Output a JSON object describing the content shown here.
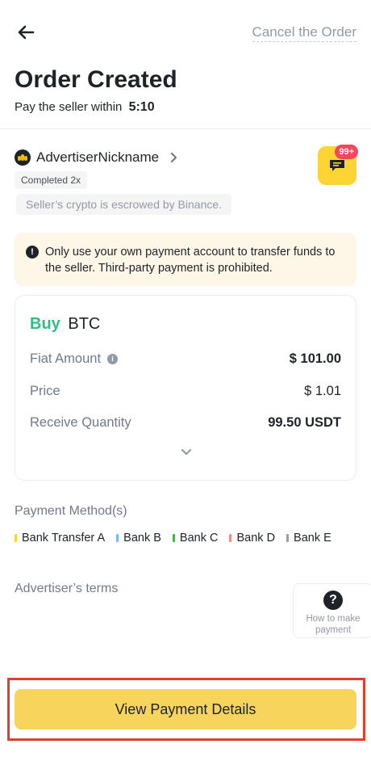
{
  "header": {
    "back_icon": "arrow-left-icon",
    "cancel_label": "Cancel the Order"
  },
  "order": {
    "title": "Order Created",
    "timer_label": "Pay the seller within",
    "timer_value": "5:10"
  },
  "advertiser": {
    "name": "AdvertiserNickname",
    "completed": "Completed 2x",
    "escrow_note": "Seller’s crypto is escrowed by Binance.",
    "chat_badge": "99+",
    "chat_icon": "chat-icon"
  },
  "notice": {
    "icon": "alert-icon",
    "text": "Only use your own payment account to transfer funds to the seller. Third-party payment is prohibited."
  },
  "card": {
    "side": "Buy",
    "asset": "BTC",
    "rows": [
      {
        "label": "Fiat Amount",
        "value": "$ 101.00",
        "info": true
      },
      {
        "label": "Price",
        "value": "$ 1.01"
      },
      {
        "label": "Receive Quantity",
        "value": "99.50 USDT"
      }
    ],
    "expand_icon": "chevron-down-icon"
  },
  "payment": {
    "title": "Payment Method(s)",
    "methods": [
      {
        "label": "Bank Transfer A",
        "color": "#fcd535"
      },
      {
        "label": "Bank B",
        "color": "#7cb7f0"
      },
      {
        "label": "Bank C",
        "color": "#4caf50"
      },
      {
        "label": "Bank D",
        "color": "#f08c8c"
      },
      {
        "label": "Bank E",
        "color": "#9e9e9e"
      }
    ]
  },
  "terms": {
    "title": "Advertiser’s terms"
  },
  "help": {
    "icon": "question-icon",
    "line1": "How to make",
    "line2": "payment"
  },
  "cta": {
    "label": "View Payment Details"
  },
  "colors": {
    "accent": "#fcd535",
    "buy": "#2ebd85",
    "alert": "#f6465d",
    "highlight": "#e53d2c"
  }
}
